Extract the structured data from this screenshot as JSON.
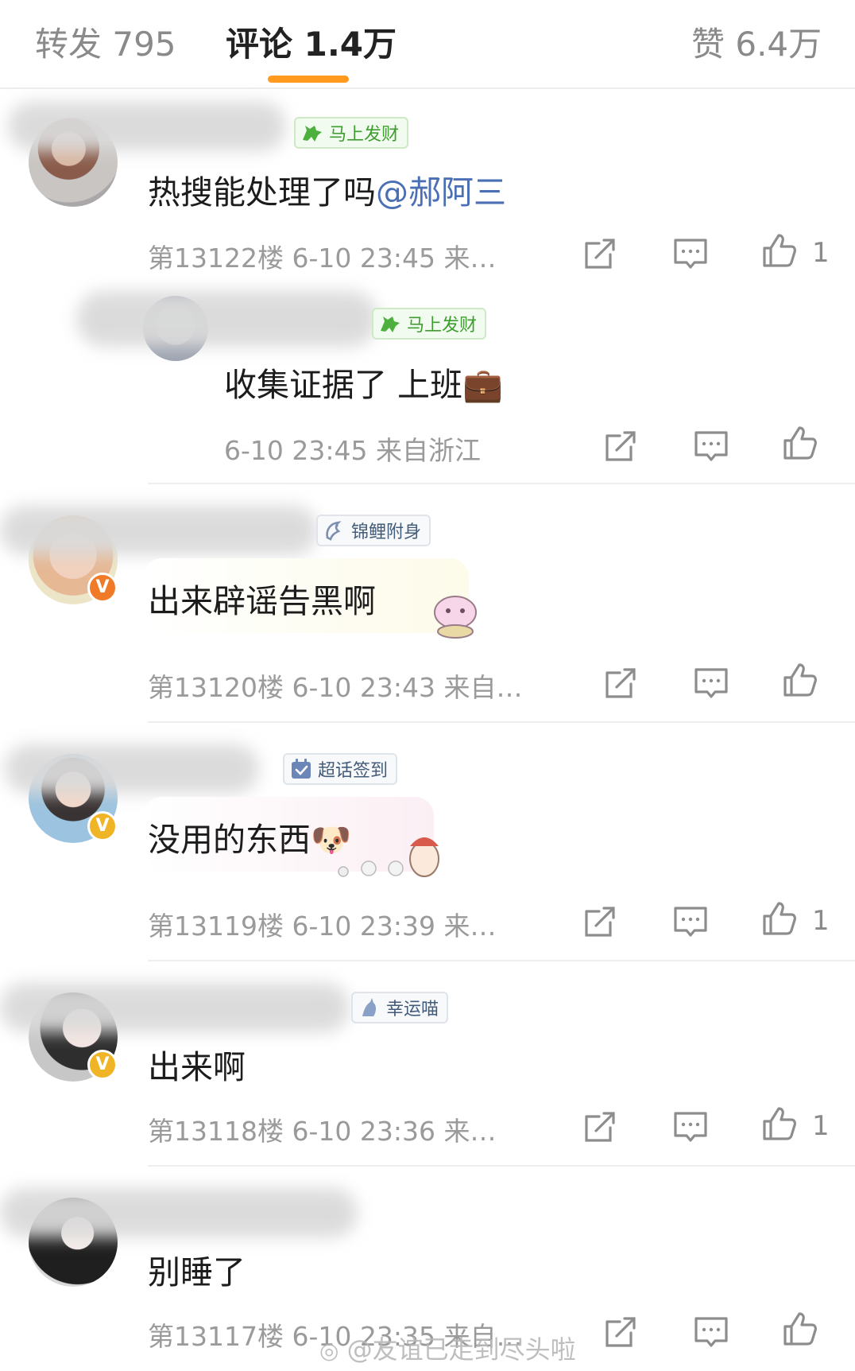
{
  "tabs": {
    "repost": "转发 795",
    "comments": "评论 1.4万",
    "likes": "赞 6.4万"
  },
  "accent_color": "#ff9a1f",
  "comments": [
    {
      "badge": "马上发财",
      "badge_icon": "horse-icon",
      "text": "热搜能处理了吗",
      "mention": "@郝阿三",
      "meta": "第13122楼  6-10 23:45  来…",
      "like_count": "1"
    },
    {
      "badge": "马上发财",
      "badge_icon": "horse-icon",
      "text": "收集证据了 上班",
      "emoji": "💼",
      "meta": "6-10 23:45  来自浙江",
      "like_count": ""
    },
    {
      "badge": "锦鲤附身",
      "badge_icon": "koi-icon",
      "text": "出来辟谣告黑啊",
      "meta": "第13120楼  6-10 23:43  来自…",
      "like_count": ""
    },
    {
      "badge": "超话签到",
      "badge_icon": "checkin-icon",
      "text": "没用的东西",
      "emoji": "🐶",
      "meta": "第13119楼  6-10 23:39  来…",
      "like_count": "1"
    },
    {
      "badge": "幸运喵",
      "badge_icon": "cat-icon",
      "text": "出来啊",
      "meta": "第13118楼  6-10 23:36  来…",
      "like_count": "1"
    },
    {
      "text": "别睡了",
      "meta": "第13117楼  6-10 23:35  来自…",
      "like_count": ""
    }
  ],
  "watermark": "@友谊已走到尽头啦",
  "icons": [
    "repost-icon",
    "reply-icon",
    "like-icon"
  ]
}
